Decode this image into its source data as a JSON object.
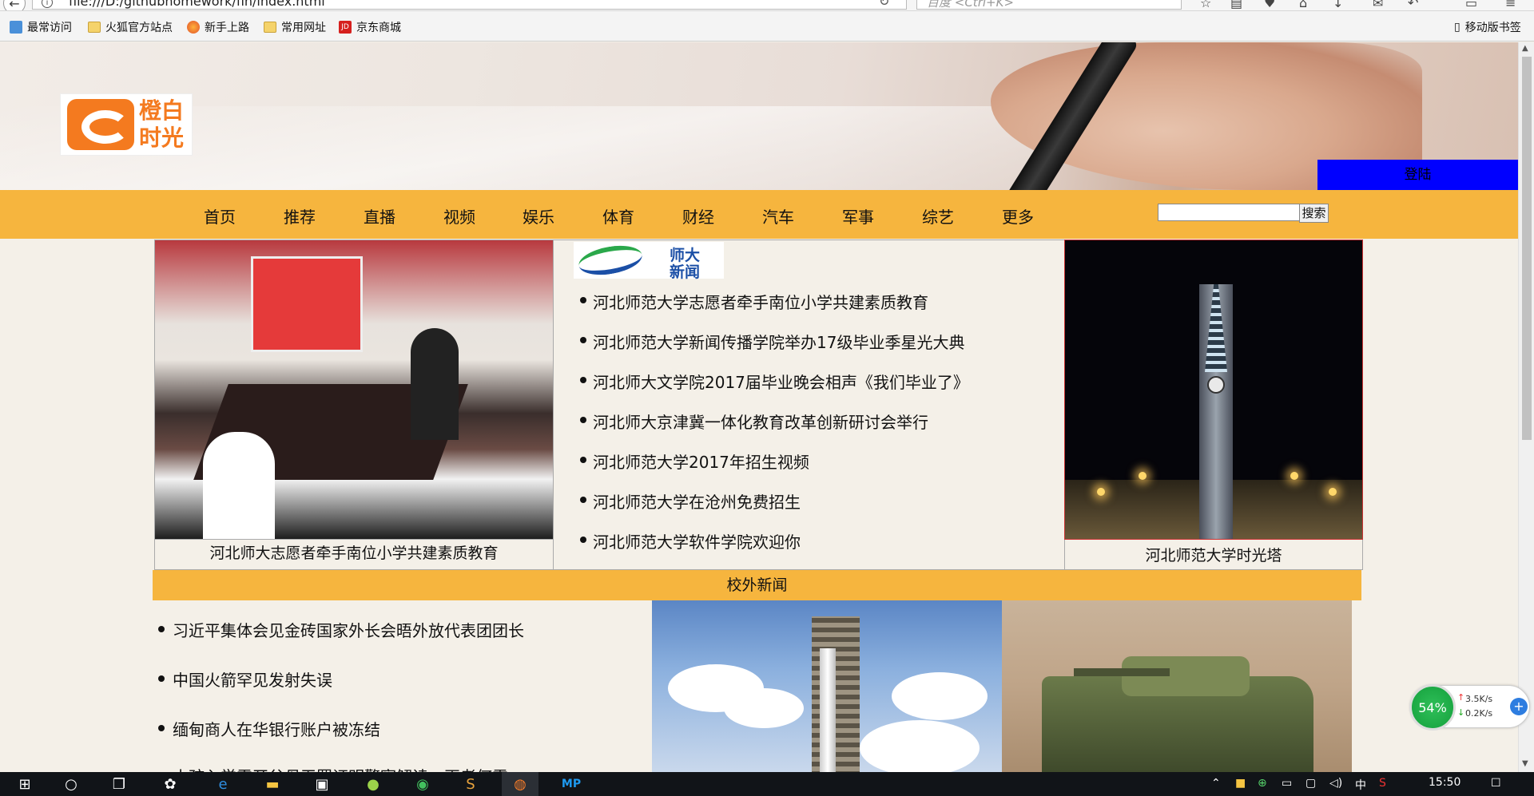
{
  "browser": {
    "url": "file:///D:/githubhomework/fin/index.html",
    "search_placeholder": "百度 <Ctrl+K>"
  },
  "bookmarks": [
    {
      "label": "最常访问"
    },
    {
      "label": "火狐官方站点"
    },
    {
      "label": "新手上路"
    },
    {
      "label": "常用网址"
    },
    {
      "label": "京东商城"
    }
  ],
  "mobile_bookmarks": "移动版书签",
  "header": {
    "logo_line1": "橙白",
    "logo_line2": "时光",
    "login_label": "登陆"
  },
  "nav": {
    "items": [
      "首页",
      "推荐",
      "直播",
      "视频",
      "娱乐",
      "体育",
      "财经",
      "汽车",
      "军事",
      "综艺",
      "更多"
    ],
    "search_button": "搜索",
    "search_value": ""
  },
  "featured": {
    "left_caption": "河北师大志愿者牵手南位小学共建素质教育",
    "right_caption": "河北师范大学时光塔",
    "news_logo_line1": "师大",
    "news_logo_line2": "新闻",
    "news": [
      "河北师范大学志愿者牵手南位小学共建素质教育",
      "河北师范大学新闻传播学院举办17级毕业季星光大典",
      "河北师大文学院2017届毕业晚会相声《我们毕业了》",
      "河北师大京津冀一体化教育改革创新研讨会举行",
      "河北师范大学2017年招生视频",
      "河北师范大学在沧州免费招生",
      "河北师范大学软件学院欢迎你"
    ]
  },
  "outside": {
    "title": "校外新闻",
    "news": [
      "习近平集体会见金砖国家外长会晤外放代表团团长",
      "中国火箭罕见发射失误",
      "缅甸商人在华银行账户被冻结",
      "小孩入学需开父母无罪证明警察解读：再者何需"
    ]
  },
  "net_widget": {
    "percent": "54%",
    "up": "3.5K/s",
    "down": "0.2K/s"
  },
  "taskbar": {
    "time": "15:50",
    "ime": "中"
  }
}
